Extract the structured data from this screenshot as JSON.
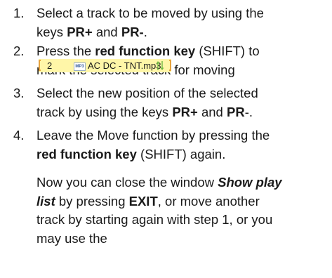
{
  "steps": [
    {
      "num": "1.",
      "lines": [
        {
          "parts": [
            {
              "t": "Select a track to be moved by using the",
              "s": "n"
            }
          ]
        },
        {
          "parts": [
            {
              "t": "keys ",
              "s": "n"
            },
            {
              "t": "PR+",
              "s": "b"
            },
            {
              "t": " and ",
              "s": "n"
            },
            {
              "t": "PR-",
              "s": "b"
            },
            {
              "t": ".",
              "s": "n"
            }
          ]
        }
      ]
    },
    {
      "num": "2.",
      "lines": [
        {
          "parts": [
            {
              "t": "Press the ",
              "s": "n"
            },
            {
              "t": "red function key",
              "s": "b"
            },
            {
              "t": " (SHIFT) to",
              "s": "n"
            }
          ]
        },
        {
          "parts": [
            {
              "t": "mark the selected track for moving",
              "s": "n"
            }
          ]
        }
      ]
    },
    {
      "num": "3.",
      "lines": [
        {
          "parts": [
            {
              "t": "Select the new position of the selected",
              "s": "n"
            }
          ]
        },
        {
          "parts": [
            {
              "t": "track by using the keys ",
              "s": "n"
            },
            {
              "t": "PR+",
              "s": "b"
            },
            {
              "t": " and ",
              "s": "n"
            },
            {
              "t": "PR",
              "s": "b"
            },
            {
              "t": "-.",
              "s": "n"
            }
          ]
        }
      ]
    },
    {
      "num": "4.",
      "lines": [
        {
          "parts": [
            {
              "t": "Leave the Move function by pressing the",
              "s": "n"
            }
          ]
        },
        {
          "parts": [
            {
              "t": "red function key",
              "s": "b"
            },
            {
              "t": " (SHIFT) again.",
              "s": "n"
            }
          ]
        }
      ]
    }
  ],
  "track_item": {
    "number": "2",
    "format_badge": "MP3",
    "name": "AC DC - TNT.mp3",
    "highlight_color": "#fff6a8",
    "bracket_color": "#e6a33c",
    "icon": "move-arrows-icon"
  },
  "closing_lines": [
    {
      "parts": [
        {
          "t": "Now you can close the window ",
          "s": "n"
        },
        {
          "t": "Show play",
          "s": "bi"
        }
      ]
    },
    {
      "parts": [
        {
          "t": "list",
          "s": "bi"
        },
        {
          "t": " by pressing ",
          "s": "n"
        },
        {
          "t": "EXIT",
          "s": "b"
        },
        {
          "t": ", or move another",
          "s": "n"
        }
      ]
    },
    {
      "parts": [
        {
          "t": "track by starting again with step 1, or you",
          "s": "n"
        }
      ]
    },
    {
      "parts": [
        {
          "t": "may use the",
          "s": "n"
        }
      ]
    }
  ]
}
